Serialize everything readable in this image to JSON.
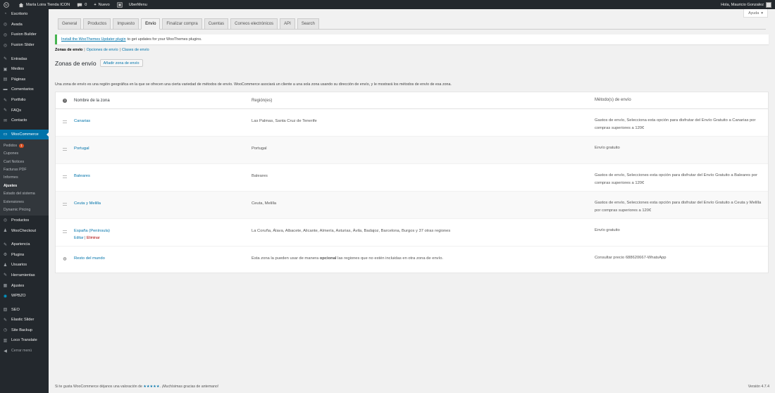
{
  "adminbar": {
    "site_name": "María Loira Tienda ICON",
    "comments_count": "0",
    "new_label": "Nuevo",
    "ubermenu_label": "UberMenu",
    "greeting": "Hola, Mauricio Gonzalez"
  },
  "sidebar": {
    "top_items": [
      "Escritorio",
      "Avada",
      "Fusion Builder",
      "Fusion Slider"
    ],
    "content_items": [
      "Entradas",
      "Medios",
      "Páginas",
      "Comentarios",
      "Portfolio",
      "FAQs",
      "Contacto"
    ],
    "current_item": "WooCommerce",
    "submenu": [
      {
        "label": "Pedidos",
        "badge": "1"
      },
      {
        "label": "Cupones"
      },
      {
        "label": "Cart Notices"
      },
      {
        "label": "Facturas PDF"
      },
      {
        "label": "Informes"
      },
      {
        "label": "Ajustes",
        "active": true
      },
      {
        "label": "Estado del sistema"
      },
      {
        "label": "Extensiones"
      },
      {
        "label": "Dynamic Pricing"
      }
    ],
    "after_items": [
      "Productos",
      "WooCheckout"
    ],
    "admin_items": [
      "Apariencia",
      "Plugins",
      "Usuarios",
      "Herramientas",
      "Ajustes",
      "WPBZO"
    ],
    "extra_items": [
      "SEO",
      "Elastic Slider",
      "Site Backup",
      "Loco Translate",
      "Cerrar menú"
    ]
  },
  "help_label": "Ayuda",
  "tabs": [
    "General",
    "Productos",
    "Impuesto",
    "Envío",
    "Finalizar compra",
    "Cuentas",
    "Correos electrónicos",
    "API",
    "Search"
  ],
  "active_tab": "Envío",
  "notice": {
    "link": "Install the WooThemes Updater plugin",
    "text": "to get updates for your WooThemes plugins."
  },
  "subnav": {
    "current": "Zonas de envío",
    "links": [
      "Opciones de envío",
      "Clases de envío"
    ]
  },
  "heading": "Zonas de envío",
  "add_zone_label": "Añadir zona de envío",
  "description": "Una zona de envío es una región geográfica en la que se ofrecen una cierta variedad de métodos de envío. WooCommerce asociará un cliente a una sola zona usando su dirección de envío, y le mostrará los métodos de envío de esa zona.",
  "table": {
    "headers": [
      "Nombre de la zona",
      "Región(es)",
      "Método(s) de envío"
    ],
    "rows": [
      {
        "name": "Canarias",
        "regions": "Las Palmas, Santa Cruz de Tenerife",
        "methods": "Gastos de envío, Selecciona esta opción para disfrutar del Envío Gratuito a Canarias por compras superiores a 120€"
      },
      {
        "name": "Portugal",
        "regions": "Portugal",
        "methods": "Envío gratuito"
      },
      {
        "name": "Baleares",
        "regions": "Baleares",
        "methods": "Gastos de envío, Selecciones esta opción para disfrutar del Envío Gratuito a Baleares por compras superiores a 120€"
      },
      {
        "name": "Ceuta y Melilla",
        "regions": "Ceuta, Melilla",
        "methods": "Gastos de envío, Selecciones esta opción para disfrutar del Envío Gratuito a Ceuta y Melilla por compras superiores a 120€"
      },
      {
        "name": "España (Península)",
        "regions": "La Coruña, Álava, Albacete, Alicante, Almería, Asturias, Ávila, Badajoz, Barcelona, Burgos y 37 otras regiones",
        "methods": "Envío gratuito",
        "actions": [
          "Editar",
          "Eliminar"
        ]
      }
    ],
    "rest": {
      "name": "Resto del mundo",
      "regions_before": "Esta zona la pueden usar de manera",
      "regions_strong": "opcional",
      "regions_after": "las regiones que no estén incluidas en otra zona de envío.",
      "methods": "Consultar precio 688620667-WhatsApp"
    }
  },
  "footer": {
    "prefix": "Si te gusta WooCommerce déjanos una valoración de",
    "stars": "★★★★★",
    "suffix": ". ¡Muchísimas gracias de antemano!",
    "version": "Versión 4.7.4"
  },
  "colors": {
    "adminbar": "#23282d",
    "accent": "#0073aa",
    "notice": "#46b450",
    "badge": "#d54e21"
  }
}
